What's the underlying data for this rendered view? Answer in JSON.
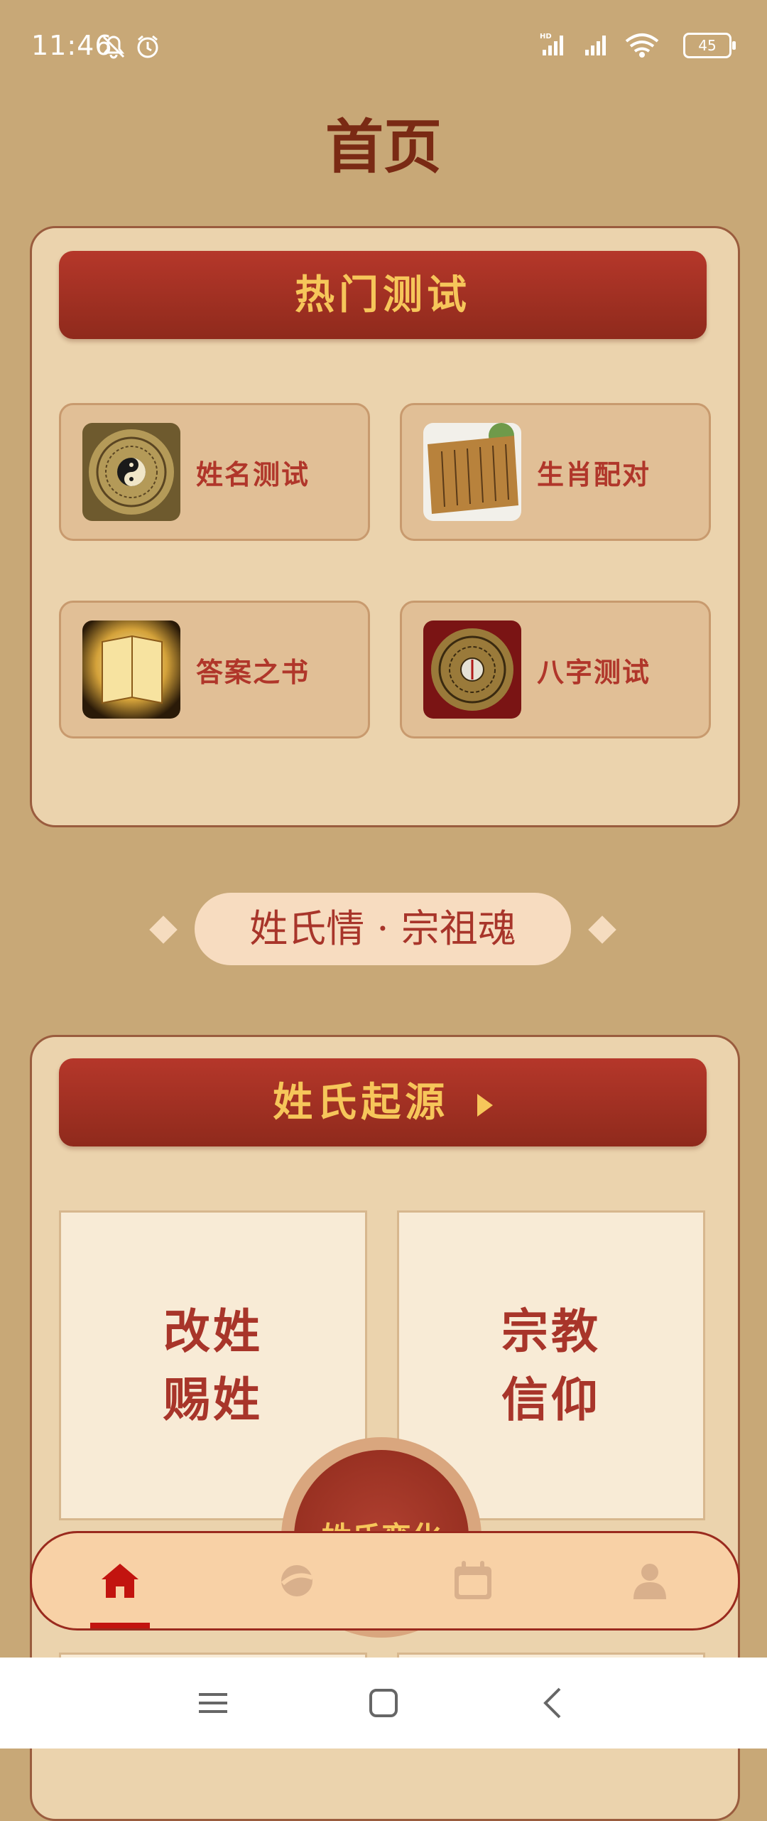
{
  "status_bar": {
    "time": "11:46",
    "battery": "45"
  },
  "page": {
    "title": "首页"
  },
  "hot_tests": {
    "banner": "热门测试",
    "items": [
      {
        "label": "姓名测试",
        "icon": "yin-yang-compass-thumbnail"
      },
      {
        "label": "生肖配对",
        "icon": "ancient-scroll-thumbnail"
      },
      {
        "label": "答案之书",
        "icon": "glowing-book-thumbnail"
      },
      {
        "label": "八字测试",
        "icon": "fengshui-compass-thumbnail"
      }
    ]
  },
  "divider": {
    "text": "姓氏情 · 宗祖魂"
  },
  "origins": {
    "banner": "姓氏起源",
    "tiles": [
      {
        "line1": "改姓",
        "line2": "赐姓"
      },
      {
        "line1": "宗教",
        "line2": "信仰"
      }
    ],
    "center": "姓氏变化"
  },
  "tab_bar": {
    "tabs": [
      {
        "icon": "home-icon",
        "active": true
      },
      {
        "icon": "planet-icon",
        "active": false
      },
      {
        "icon": "calendar-icon",
        "active": false
      },
      {
        "icon": "user-icon",
        "active": false
      }
    ]
  },
  "colors": {
    "background": "#c8a877",
    "card": "#ebd3ad",
    "banner": "#a3311f",
    "banner_text": "#f6c65a",
    "accent_red": "#c2140f",
    "tab_bar": "#f8d1a6"
  }
}
